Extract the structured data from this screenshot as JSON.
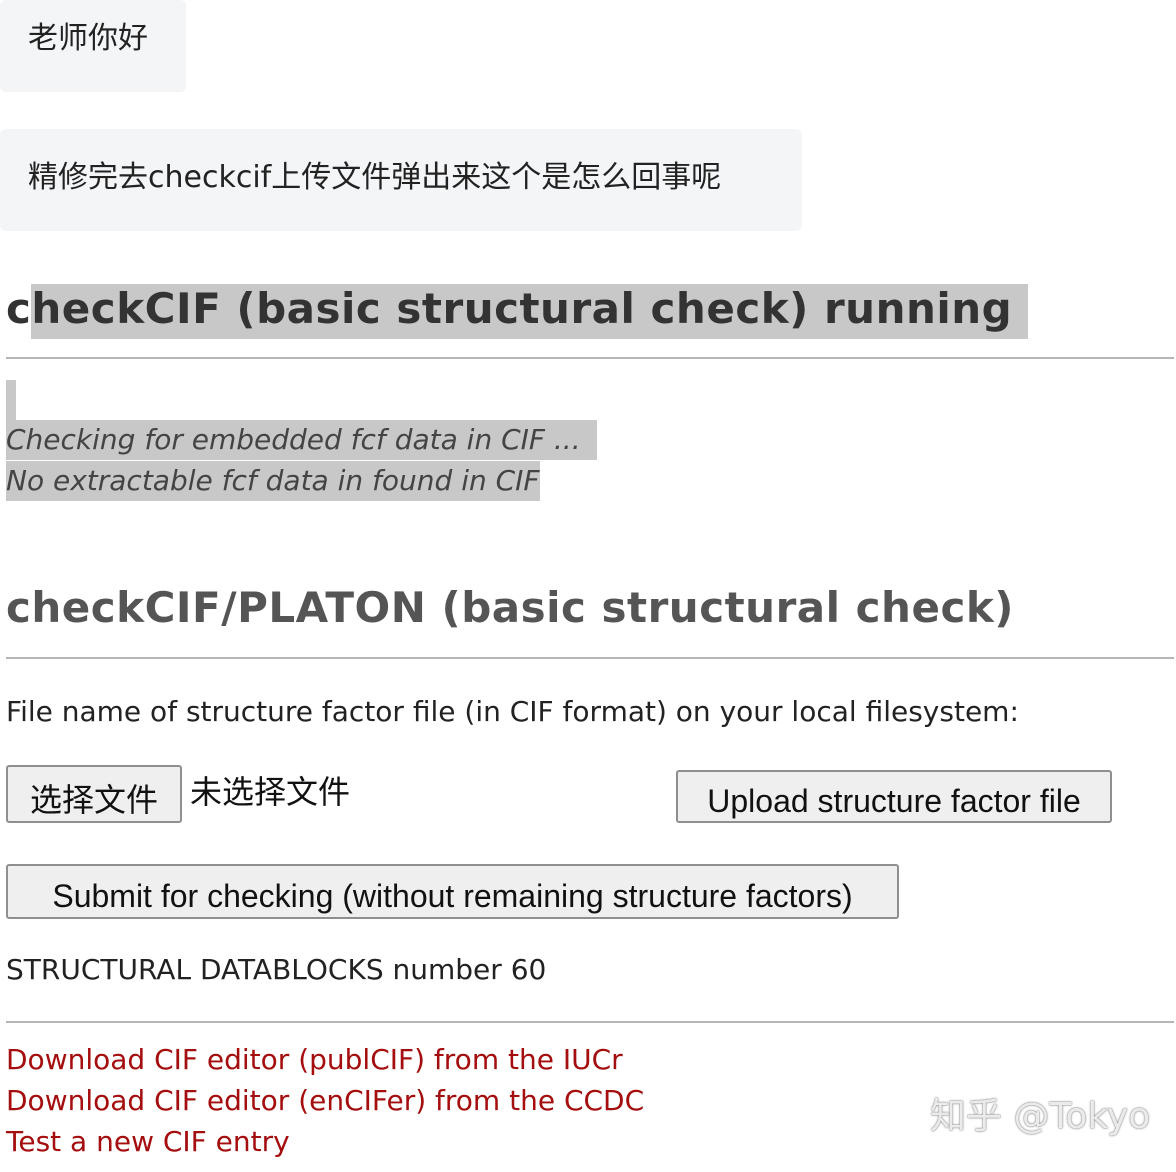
{
  "chat": {
    "message_1": "老师你好",
    "message_2": "精修完去checkcif上传文件弹出来这个是怎么回事呢"
  },
  "running_section": {
    "title": "checkCIF (basic structural check) running",
    "status_line_1": "Checking for embedded fcf data in CIF ...",
    "status_line_2": "No extractable fcf data in found in CIF"
  },
  "platon_section": {
    "title": "checkCIF/PLATON (basic structural check)",
    "file_label": "File name of structure factor file (in CIF format) on your local filesystem:",
    "choose_file_label": "选择文件",
    "no_file_text": "未选择文件",
    "upload_label": "Upload structure factor file",
    "submit_label": "Submit for checking (without remaining structure factors)",
    "datablocks_text": "STRUCTURAL DATABLOCKS number 60"
  },
  "links": [
    "Download CIF editor (publCIF) from the IUCr",
    "Download CIF editor (enCIFer) from the CCDC",
    "Test a new CIF entry"
  ],
  "watermark": "知乎 @Tokyo",
  "colors": {
    "link": "#a50e0e",
    "highlight": "#c8c8c8",
    "bubble": "#f4f5f7"
  }
}
